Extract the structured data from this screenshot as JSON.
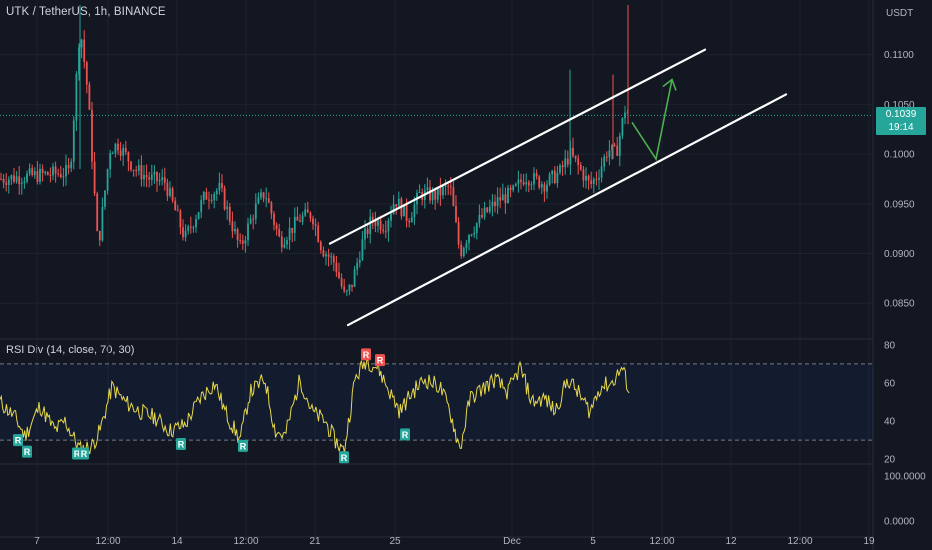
{
  "header": {
    "title": "UTK / TetherUS, 1h, BINANCE",
    "currency": "USDT"
  },
  "price_tag": {
    "price": "0.1039",
    "countdown": "19:14"
  },
  "colors": {
    "background": "#131722",
    "up": "#26a69a",
    "down": "#ef5350",
    "rsi_line": "#e6d84a",
    "channel": "#ffffff",
    "projection": "#4caf50"
  },
  "chart_data": [
    {
      "type": "candlestick",
      "title": "UTK / TetherUS, 1h, BINANCE",
      "ylabel": "USDT",
      "ylim": [
        0.0815,
        0.1155
      ],
      "y_ticks": [
        "0.1100",
        "0.1050",
        "0.1000",
        "0.0950",
        "0.0900",
        "0.0850"
      ],
      "x_ticks": [
        "7",
        "12:00",
        "14",
        "12:00",
        "21",
        "25",
        "Dec",
        "5",
        "12:00",
        "12",
        "12:00",
        "19"
      ],
      "last_price": 0.1039,
      "price_path": [
        [
          0,
          0.0975
        ],
        [
          70,
          0.0982
        ],
        [
          80,
          0.113
        ],
        [
          88,
          0.106
        ],
        [
          98,
          0.0905
        ],
        [
          110,
          0.1005
        ],
        [
          118,
          0.101
        ],
        [
          135,
          0.0985
        ],
        [
          150,
          0.0975
        ],
        [
          165,
          0.0972
        ],
        [
          185,
          0.0915
        ],
        [
          205,
          0.0958
        ],
        [
          220,
          0.0965
        ],
        [
          240,
          0.0905
        ],
        [
          255,
          0.0945
        ],
        [
          265,
          0.0962
        ],
        [
          280,
          0.0912
        ],
        [
          300,
          0.0935
        ],
        [
          312,
          0.094
        ],
        [
          322,
          0.0905
        ],
        [
          335,
          0.089
        ],
        [
          345,
          0.0855
        ],
        [
          352,
          0.087
        ],
        [
          362,
          0.091
        ],
        [
          372,
          0.0935
        ],
        [
          385,
          0.0928
        ],
        [
          395,
          0.0955
        ],
        [
          408,
          0.0935
        ],
        [
          420,
          0.096
        ],
        [
          435,
          0.0958
        ],
        [
          450,
          0.0968
        ],
        [
          460,
          0.09
        ],
        [
          468,
          0.092
        ],
        [
          485,
          0.094
        ],
        [
          500,
          0.0955
        ],
        [
          512,
          0.096
        ],
        [
          525,
          0.0978
        ],
        [
          545,
          0.097
        ],
        [
          560,
          0.0982
        ],
        [
          570,
          0.1
        ],
        [
          580,
          0.0985
        ],
        [
          590,
          0.0968
        ],
        [
          598,
          0.098
        ],
        [
          608,
          0.1005
        ],
        [
          616,
          0.1
        ],
        [
          625,
          0.1045
        ],
        [
          630,
          0.1039
        ]
      ],
      "channel": {
        "upper": [
          [
            330,
            0.091
          ],
          [
            705,
            0.1105
          ]
        ],
        "lower": [
          [
            348,
            0.0828
          ],
          [
            786,
            0.106
          ]
        ]
      },
      "projection": [
        [
          632,
          0.1032
        ],
        [
          656,
          0.0995
        ],
        [
          672,
          0.1075
        ]
      ]
    },
    {
      "type": "line",
      "title": "RSI Div (14, close, 70, 30)",
      "ylim": [
        18,
        82
      ],
      "y_ticks": [
        "80",
        "60",
        "40",
        "20"
      ],
      "bands": [
        70,
        30
      ],
      "signal_label": "R",
      "bearish_markers": [
        [
          366,
          75
        ],
        [
          380,
          72
        ]
      ],
      "bullish_markers": [
        [
          18,
          30
        ],
        [
          27,
          24
        ],
        [
          77,
          23
        ],
        [
          84,
          23
        ],
        [
          181,
          28
        ],
        [
          243,
          27
        ],
        [
          344,
          21
        ],
        [
          405,
          33
        ]
      ],
      "rsi_path": [
        [
          0,
          50
        ],
        [
          15,
          42
        ],
        [
          25,
          32
        ],
        [
          40,
          48
        ],
        [
          55,
          35
        ],
        [
          65,
          40
        ],
        [
          80,
          25
        ],
        [
          92,
          27
        ],
        [
          100,
          35
        ],
        [
          112,
          58
        ],
        [
          125,
          50
        ],
        [
          140,
          45
        ],
        [
          155,
          42
        ],
        [
          170,
          35
        ],
        [
          185,
          38
        ],
        [
          200,
          52
        ],
        [
          215,
          60
        ],
        [
          225,
          45
        ],
        [
          240,
          30
        ],
        [
          250,
          55
        ],
        [
          265,
          62
        ],
        [
          275,
          35
        ],
        [
          285,
          32
        ],
        [
          300,
          62
        ],
        [
          312,
          45
        ],
        [
          325,
          40
        ],
        [
          335,
          30
        ],
        [
          344,
          24
        ],
        [
          355,
          62
        ],
        [
          366,
          72
        ],
        [
          378,
          68
        ],
        [
          390,
          55
        ],
        [
          400,
          45
        ],
        [
          412,
          55
        ],
        [
          425,
          62
        ],
        [
          440,
          58
        ],
        [
          450,
          45
        ],
        [
          460,
          25
        ],
        [
          470,
          52
        ],
        [
          485,
          58
        ],
        [
          495,
          62
        ],
        [
          508,
          55
        ],
        [
          520,
          68
        ],
        [
          532,
          50
        ],
        [
          545,
          52
        ],
        [
          555,
          45
        ],
        [
          568,
          62
        ],
        [
          578,
          55
        ],
        [
          590,
          45
        ],
        [
          600,
          58
        ],
        [
          612,
          60
        ],
        [
          622,
          68
        ],
        [
          630,
          55
        ]
      ]
    },
    {
      "type": "line",
      "title": "",
      "y_ticks": [
        "100.0000",
        "0.0000"
      ]
    }
  ]
}
